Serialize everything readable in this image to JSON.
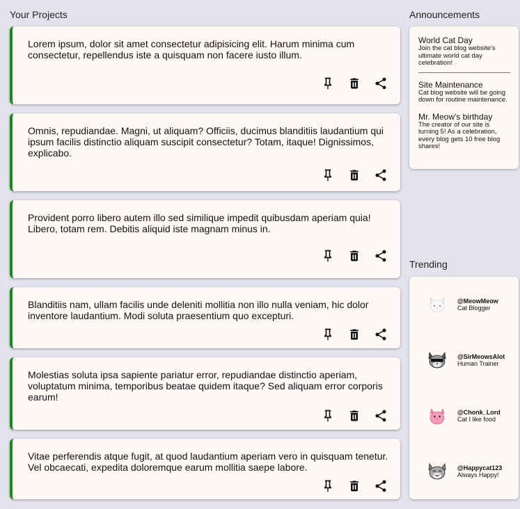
{
  "projects": {
    "title": "Your Projects",
    "accent_color": "#188a18",
    "items": [
      {
        "text": "Lorem ipsum, dolor sit amet consectetur adipisicing elit. Harum minima cum consectetur, repellendus iste a quisquam non facere iusto illum."
      },
      {
        "text": "Omnis, repudiandae. Magni, ut aliquam? Officiis, ducimus blanditiis laudantium qui ipsum facilis distinctio aliquam suscipit consectetur? Totam, itaque! Dignissimos, explicabo."
      },
      {
        "text": "Provident porro libero autem illo sed similique impedit quibusdam aperiam quia! Libero, totam rem. Debitis aliquid iste magnam minus in."
      },
      {
        "text": "Blanditiis nam, ullam facilis unde deleniti mollitia non illo nulla veniam, hic dolor inventore laudantium. Modi soluta praesentium quo excepturi."
      },
      {
        "text": "Molestias soluta ipsa sapiente pariatur error, repudiandae distinctio aperiam, voluptatum minima, temporibus beatae quidem itaque? Sed aliquam error corporis earum!"
      },
      {
        "text": "Vitae perferendis atque fugit, at quod laudantium aperiam vero in quisquam tenetur. Vel obcaecati, expedita doloremque earum mollitia saepe labore."
      }
    ],
    "actions": [
      "pin-icon",
      "trash-icon",
      "share-icon"
    ]
  },
  "announcements": {
    "title": "Announcements",
    "items": [
      {
        "title": "World Cat Day",
        "body": "Join the cat blog website's ultimate world cat day celebration!"
      },
      {
        "title": "Site Maintenance",
        "body": "Cat blog website will be going down for routine maintenance."
      },
      {
        "title": "Mr. Meow's birthday",
        "body": "The creator of our site is turning 5! As a celebration, every blog gets 10 free blog shares!"
      }
    ]
  },
  "trending": {
    "title": "Trending",
    "items": [
      {
        "handle": "@MeowMeow",
        "desc": "Cat Blogger",
        "avatar": "white-cat-avatar"
      },
      {
        "handle": "@SirMeowsAlot",
        "desc": "Human Trainer",
        "avatar": "sunglasses-cat-avatar"
      },
      {
        "handle": "@Chonk_Lord",
        "desc": "Cat I like food",
        "avatar": "pink-cat-avatar"
      },
      {
        "handle": "@Happycat123",
        "desc": "Always Happy!",
        "avatar": "happy-cat-avatar"
      }
    ]
  }
}
